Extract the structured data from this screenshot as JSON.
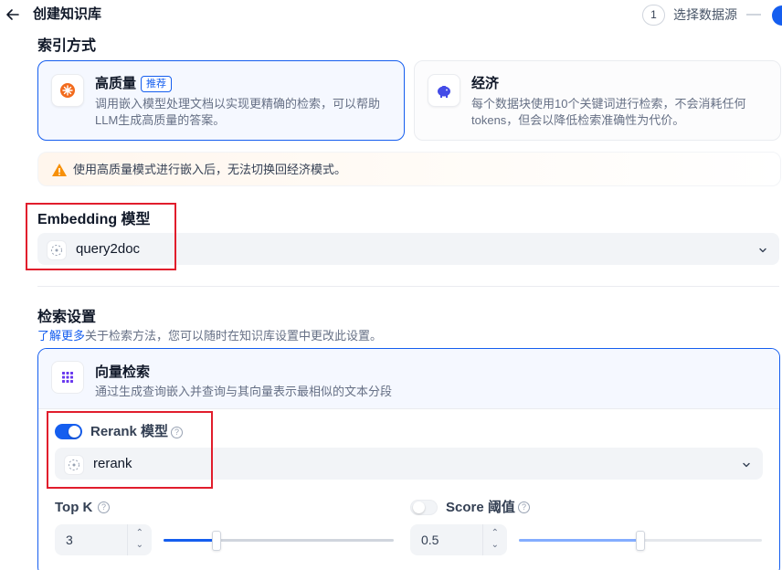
{
  "header": {
    "back_icon": "arrow-left-icon",
    "title": "创建知识库",
    "step_number": "1",
    "step_label": "选择数据源"
  },
  "index_section": {
    "title": "索引方式",
    "options": [
      {
        "title": "高质量",
        "badge": "推荐",
        "desc": "调用嵌入模型处理文档以实现更精确的检索，可以帮助LLM生成高质量的答案。",
        "icon": "sparkle-icon",
        "selected": true
      },
      {
        "title": "经济",
        "desc": "每个数据块使用10个关键词进行检索，不会消耗任何 tokens，但会以降低检索准确性为代价。",
        "icon": "piggy-bank-icon",
        "selected": false
      }
    ],
    "warning": "使用高质量模式进行嵌入后，无法切换回经济模式。"
  },
  "embedding": {
    "title": "Embedding 模型",
    "model": "query2doc"
  },
  "retrieval": {
    "title": "检索设置",
    "learn_more": "了解更多",
    "desc": "关于检索方法，您可以随时在知识库设置中更改此设置。",
    "vector": {
      "title": "向量检索",
      "desc": "通过生成查询嵌入并查询与其向量表示最相似的文本分段"
    },
    "rerank": {
      "label": "Rerank 模型",
      "enabled": true,
      "model": "rerank"
    },
    "top_k": {
      "label": "Top K",
      "value": "3",
      "slider_fraction": 0.23
    },
    "score": {
      "label": "Score 阈值",
      "enabled": false,
      "value": "0.5",
      "slider_fraction": 0.5
    }
  },
  "colors": {
    "accent": "#155eef",
    "warning": "#f79009",
    "annotation_box": "#e11d2c"
  }
}
